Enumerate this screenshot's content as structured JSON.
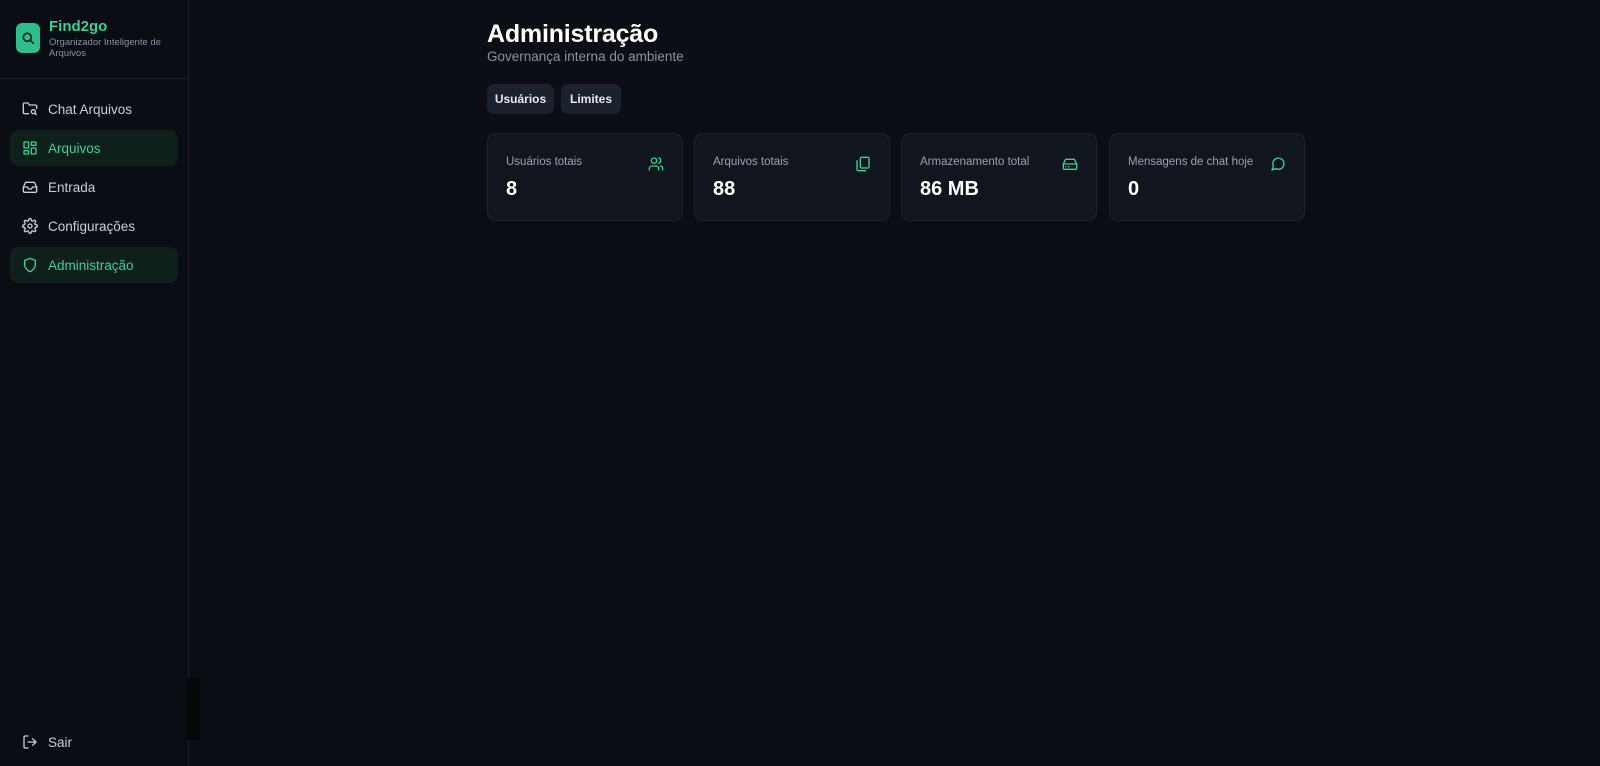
{
  "colors": {
    "accent": "#3ecf99",
    "background": "#0b0e14",
    "card": "#11151d",
    "active_nav_bg": "#0f1f1b"
  },
  "brand": {
    "name": "Find2go",
    "subtitle": "Organizador Inteligente de Arquivos",
    "icon": "search-icon"
  },
  "sidebar": {
    "items": [
      {
        "label": "Chat Arquivos",
        "icon": "folder-search-icon",
        "active": false
      },
      {
        "label": "Arquivos",
        "icon": "grid-icon",
        "active": true
      },
      {
        "label": "Entrada",
        "icon": "inbox-icon",
        "active": false
      },
      {
        "label": "Configurações",
        "icon": "gear-icon",
        "active": false
      },
      {
        "label": "Administração",
        "icon": "shield-icon",
        "active": true
      }
    ],
    "logout": {
      "label": "Sair",
      "icon": "logout-icon"
    }
  },
  "header": {
    "title": "Administração",
    "subtitle": "Governança interna do ambiente"
  },
  "tabs": [
    {
      "label": "Usuários"
    },
    {
      "label": "Limites"
    }
  ],
  "stats": [
    {
      "label": "Usuários totais",
      "value": "8",
      "icon": "users-icon"
    },
    {
      "label": "Arquivos totais",
      "value": "88",
      "icon": "files-icon"
    },
    {
      "label": "Armazenamento total",
      "value": "86 MB",
      "icon": "hard-drive-icon"
    },
    {
      "label": "Mensagens de chat hoje",
      "value": "0",
      "icon": "message-circle-icon"
    }
  ]
}
